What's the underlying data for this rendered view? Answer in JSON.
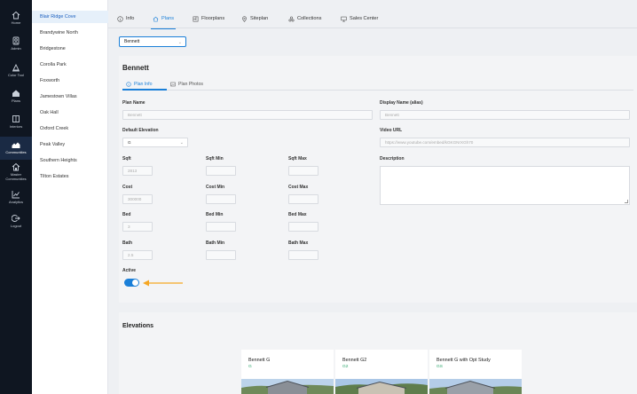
{
  "nav": [
    {
      "label": "Home",
      "icon": "home-icon"
    },
    {
      "label": "Admin",
      "icon": "admin-icon"
    },
    {
      "label": "Color Tool",
      "icon": "color-tool-icon"
    },
    {
      "label": "Plans",
      "icon": "plans-icon"
    },
    {
      "label": "Interiors",
      "icon": "interiors-icon"
    },
    {
      "label": "Communities",
      "icon": "communities-icon"
    },
    {
      "label": "Master Communities",
      "icon": "master-communities-icon"
    },
    {
      "label": "Analytics",
      "icon": "analytics-icon"
    },
    {
      "label": "Logout",
      "icon": "logout-icon"
    }
  ],
  "communities": [
    "Blair Ridge Cove",
    "Brandywine North",
    "Bridgestone",
    "Corolla Park",
    "Foxworth",
    "Jamestown Villas",
    "Oak Hall",
    "Oxford Creek",
    "Peak Valley",
    "Southern Heights",
    "Tilton Estates"
  ],
  "tabs": [
    {
      "label": "Info",
      "icon": "info-icon"
    },
    {
      "label": "Plans",
      "icon": "home-icon"
    },
    {
      "label": "Floorplans",
      "icon": "floorplan-icon"
    },
    {
      "label": "Siteplan",
      "icon": "location-pin-icon"
    },
    {
      "label": "Collections",
      "icon": "collections-icon"
    },
    {
      "label": "Sales Center",
      "icon": "monitor-icon"
    }
  ],
  "plan_select": {
    "value": "Bennett"
  },
  "plan": {
    "title": "Bennett",
    "subtabs": [
      "Plan Info",
      "Plan Photos"
    ],
    "labels": {
      "plan_name": "Plan Name",
      "display_name": "Display Name (alias)",
      "default_elevation": "Default Elevation",
      "video_url": "Video URL",
      "sqft": "Sqft",
      "sqft_min": "Sqft Min",
      "sqft_max": "Sqft Max",
      "description": "Description",
      "cost": "Cost",
      "cost_min": "Cost Min",
      "cost_max": "Cost Max",
      "bed": "Bed",
      "bed_min": "Bed Min",
      "bed_max": "Bed Max",
      "bath": "Bath",
      "bath_min": "Bath Min",
      "bath_max": "Bath Max",
      "active": "Active"
    },
    "values": {
      "plan_name": "Bennett",
      "display_name": "Bennett",
      "default_elevation": "G",
      "video_url": "https://www.youtube.com/embed/kGKGNrXGh70",
      "sqft": "2813",
      "cost": "300000",
      "bed": "3",
      "bath": "2.5"
    },
    "active": true
  },
  "elevations": {
    "title": "Elevations",
    "items": [
      {
        "name": "Bennett G",
        "code": "G"
      },
      {
        "name": "Bennett G2",
        "code": "G2"
      },
      {
        "name": "Bennett G with Opt Study",
        "code": "GS"
      }
    ]
  },
  "colors": {
    "accent": "#1a7fd8",
    "nav_bg": "#0f1621",
    "arrow": "#f5a623",
    "code_green": "#2aa56a"
  }
}
